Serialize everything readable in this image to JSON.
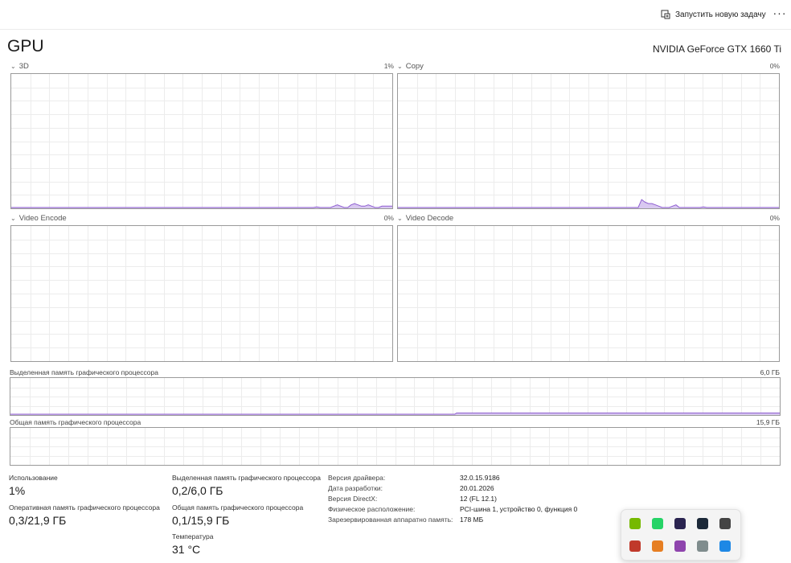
{
  "toolbar": {
    "run_task_label": "Запустить новую задачу",
    "more_label": "···"
  },
  "header": {
    "title": "GPU",
    "device": "NVIDIA GeForce GTX 1660 Ti"
  },
  "engines": [
    {
      "label": "3D",
      "percent": "1%",
      "activity": [
        0,
        0,
        0,
        0,
        0,
        0,
        0,
        0,
        0,
        0,
        0,
        0,
        0,
        0,
        0,
        0,
        0,
        0,
        0,
        0,
        0,
        0,
        0,
        0,
        0,
        0,
        0,
        0,
        0,
        0,
        0,
        0,
        0,
        0,
        0,
        0,
        0,
        0,
        0,
        0,
        0,
        0,
        0,
        0,
        0,
        0,
        0,
        0,
        0,
        0,
        0,
        0,
        0,
        0,
        0,
        0,
        0,
        0,
        0,
        0,
        0,
        0,
        0,
        0,
        0,
        0,
        0,
        0,
        0,
        0,
        0,
        0,
        0,
        0,
        0,
        0,
        0,
        0,
        0,
        0,
        0,
        0,
        0,
        0,
        0,
        0,
        0,
        0,
        0,
        0.5,
        0,
        0,
        0,
        0,
        1,
        2,
        1,
        0,
        0,
        2,
        3,
        2,
        1,
        1,
        2,
        1,
        0,
        0,
        1,
        1,
        1,
        1
      ]
    },
    {
      "label": "Copy",
      "percent": "0%",
      "activity": [
        0,
        0,
        0,
        0,
        0,
        0,
        0,
        0,
        0,
        0,
        0,
        0,
        0,
        0,
        0,
        0,
        0,
        0,
        0,
        0,
        0,
        0,
        0,
        0,
        0,
        0,
        0,
        0,
        0,
        0,
        0,
        0,
        0,
        0,
        0,
        0,
        0,
        0,
        0,
        0,
        0,
        0,
        0,
        0,
        0,
        0,
        0,
        0,
        0,
        0,
        0,
        0,
        0,
        0,
        0,
        0,
        0,
        0,
        0,
        0,
        0,
        0,
        0,
        0,
        0,
        0,
        0,
        0,
        0,
        0,
        0,
        6,
        4,
        3,
        3,
        2,
        1,
        0,
        0,
        0,
        1,
        2,
        0,
        0,
        0,
        0,
        0,
        0,
        0,
        0.5,
        0,
        0,
        0,
        0,
        0,
        0,
        0,
        0,
        0,
        0,
        0,
        0,
        0,
        0,
        0,
        0,
        0,
        0,
        0,
        0,
        0,
        0
      ]
    },
    {
      "label": "Video Encode",
      "percent": "0%",
      "activity": []
    },
    {
      "label": "Video Decode",
      "percent": "0%",
      "activity": []
    }
  ],
  "memory": {
    "dedicated": {
      "label": "Выделенная память графического процессора",
      "max": "6,0 ГБ",
      "activity": [
        0,
        0,
        0,
        0,
        0,
        0,
        0,
        0,
        0,
        0,
        0,
        0,
        0,
        0,
        0,
        0,
        0,
        0,
        0,
        0,
        0,
        0,
        0,
        0,
        0,
        0,
        0,
        0,
        0,
        0,
        0,
        0,
        0,
        0,
        0,
        0,
        0,
        0,
        0,
        0,
        0,
        0,
        0,
        0,
        0,
        0,
        0,
        0,
        0,
        0,
        0,
        0,
        0,
        0,
        0,
        0,
        0,
        0,
        0,
        0,
        0,
        0,
        0,
        0,
        0,
        0,
        0,
        0,
        0,
        0,
        0,
        0,
        0,
        0,
        0,
        0,
        0,
        0,
        0,
        0,
        0,
        0,
        0,
        0,
        0,
        0,
        0,
        0,
        0,
        0,
        0,
        0,
        0,
        0,
        0,
        0,
        0,
        0,
        0,
        0,
        0,
        0,
        0,
        0,
        0,
        0,
        0,
        0,
        0,
        0,
        0,
        0,
        0,
        0,
        0,
        0,
        0,
        0,
        0,
        0,
        0,
        0,
        0,
        0,
        0,
        0,
        0,
        0,
        0,
        0,
        0,
        0,
        0,
        0,
        0,
        0,
        0,
        0,
        0,
        0,
        0,
        0,
        0,
        0,
        0,
        0,
        0,
        0,
        0,
        0,
        0,
        0,
        0,
        0,
        0,
        0,
        0,
        0,
        0,
        0,
        0,
        0,
        0,
        0,
        0,
        0,
        0,
        0,
        0,
        0,
        0,
        0,
        0,
        0,
        0,
        0,
        0,
        0,
        0,
        0,
        0,
        0,
        0,
        0,
        0,
        0,
        0,
        0,
        0,
        0,
        0,
        0,
        0,
        0,
        0,
        0,
        0,
        0,
        0,
        0,
        0,
        0,
        0,
        0,
        0,
        0,
        0,
        0,
        0,
        0,
        0,
        0,
        0,
        0,
        0,
        0,
        0,
        0,
        0,
        0,
        0,
        0,
        0,
        0,
        0,
        0,
        0,
        0,
        0,
        0,
        0,
        0,
        0,
        0,
        0,
        0,
        0,
        0,
        0,
        0,
        0,
        0,
        0,
        3.3,
        3.3,
        3.3,
        3.3,
        3.3,
        3.3,
        3.3,
        3.3,
        3.3,
        3.3,
        3.3,
        3.3,
        3.3,
        3.3,
        3.3,
        3.3,
        3.3,
        3.3,
        3.3,
        3.3,
        3.3,
        3.3,
        3.3,
        3.3,
        3.3,
        3.3,
        3.3,
        3.3,
        3.3,
        3.3,
        3.3,
        3.3,
        3.3,
        3.3,
        3.3,
        3.3,
        3.3,
        3.3,
        3.3,
        3.3,
        3.3,
        3.3,
        3.3,
        3.3,
        3.3,
        3.3,
        3.3,
        3.3,
        3.3,
        3.3,
        3.3,
        3.3,
        3.3,
        3.3,
        3.3,
        3.3,
        3.3,
        3.3,
        3.3,
        3.3,
        3.3,
        3.3,
        3.3,
        3.3,
        3.3,
        3.3,
        3.3,
        3.3,
        3.3,
        3.3,
        3.3,
        3.3,
        3.3,
        3.3,
        3.3,
        3.3,
        3.3,
        3.3,
        3.3,
        3.3,
        3.3,
        3.3,
        3.3,
        3.3,
        3.3,
        3.3,
        3.3,
        3.3,
        3.3,
        3.3,
        3.3,
        3.3,
        3.3,
        3.3,
        3.3,
        3.3,
        3.3,
        3.3,
        3.3,
        3.3,
        3.3,
        3.3,
        3.3,
        3.3,
        3.3,
        3.3,
        3.3,
        3.3,
        3.3,
        3.3,
        3.3,
        3.3,
        3.3,
        3.3,
        3.3,
        3.3,
        3.3,
        3.3,
        3.3,
        3.3,
        3.3,
        3.3,
        3.3,
        3.3,
        3.3,
        3.3,
        3.3,
        3.3,
        3.3,
        3.3,
        3.3,
        3.3,
        3.3,
        3.3,
        3.3,
        3.3,
        3.3,
        3.3,
        3.3,
        3.3,
        3.3,
        3.3,
        3.3,
        3.3,
        3.3,
        3.3,
        3.3,
        3.3,
        3.3,
        3.3,
        3.3,
        3.3,
        3.3,
        3.3,
        3.3,
        3.3,
        3.3,
        3.3,
        3.3,
        3.3,
        3.3,
        3.3,
        3.3,
        3.3,
        3.3,
        3.3,
        3.3,
        3.3,
        3.3,
        3.3,
        3.3,
        3.3,
        3.3,
        3.3,
        3.3,
        3.3,
        3.3
      ]
    },
    "shared": {
      "label": "Общая память графического процессора",
      "max": "15,9 ГБ",
      "activity": []
    }
  },
  "stats": {
    "utilization": {
      "label": "Использование",
      "value": "1%"
    },
    "gpu_ram": {
      "label": "Оперативная память графического процессора",
      "value": "0,3/21,9 ГБ"
    },
    "dedicated": {
      "label": "Выделенная память графического процессора",
      "value": "0,2/6,0 ГБ"
    },
    "shared": {
      "label": "Общая память графического процессора",
      "value": "0,1/15,9 ГБ"
    },
    "temperature": {
      "label": "Температура",
      "value": "31 °C"
    }
  },
  "info": [
    {
      "label": "Версия драйвера:",
      "value": "32.0.15.9186"
    },
    {
      "label": "Дата разработки:",
      "value": "20.01.2026"
    },
    {
      "label": "Версия DirectX:",
      "value": "12 (FL 12.1)"
    },
    {
      "label": "Физическое расположение:",
      "value": "PCI-шина 1, устройство 0, функция 0"
    },
    {
      "label": "Зарезервированная аппаратно память:",
      "value": "178 МБ"
    }
  ],
  "tray": [
    {
      "name": "nvidia-icon",
      "color": "#76b900"
    },
    {
      "name": "whatsapp-icon",
      "color": "#25d366"
    },
    {
      "name": "app-dark-icon",
      "color": "#2a2450"
    },
    {
      "name": "steam-icon",
      "color": "#1b2838"
    },
    {
      "name": "network-icon",
      "color": "#444444"
    },
    {
      "name": "antivirus-icon",
      "color": "#c0392b"
    },
    {
      "name": "sticky-icon",
      "color": "#e67e22"
    },
    {
      "name": "pen-icon",
      "color": "#8e44ad"
    },
    {
      "name": "window-icon",
      "color": "#7f8c8d"
    },
    {
      "name": "bluetooth-icon",
      "color": "#1e88e5"
    }
  ],
  "colors": {
    "line": "#8f5fd1",
    "fill": "#d8c8f0",
    "grid": "#ececec",
    "border": "#9a9a9a"
  }
}
